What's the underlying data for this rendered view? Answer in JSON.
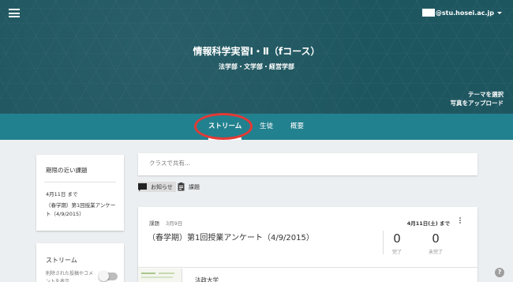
{
  "header": {
    "account_email": "@stu.hosei.ac.jp",
    "course_title": "情報科学実習Ⅰ・Ⅱ（fコース）",
    "course_subtitle": "法学部・文学部・経営学部",
    "theme_select": "テーマを選択",
    "photo_upload": "写真をアップロード"
  },
  "tabs": [
    {
      "label": "ストリーム",
      "active": true
    },
    {
      "label": "生徒",
      "active": false
    },
    {
      "label": "概要",
      "active": false
    }
  ],
  "sidebar": {
    "upcoming_title": "期限の近い課題",
    "upcoming_due": "4月11日 まで",
    "upcoming_item": "（春学期）第1回授業アンケート（4/9/2015）",
    "stream_title": "ストリーム",
    "stream_desc": "削除された投稿やコメントを表示",
    "stream_toggle_on": false
  },
  "share": {
    "placeholder": "クラスで共有..."
  },
  "post_types": {
    "announcement": "お知らせ",
    "assignment": "課題"
  },
  "post": {
    "kind": "課題",
    "date": "3月9日",
    "due": "4月11日(土) まで",
    "title": "（春学期）第1回授業アンケート（4/9/2015）",
    "done_count": "0",
    "done_label": "完了",
    "notdone_count": "0",
    "notdone_label": "未完了",
    "attachment_name": "法政大学"
  },
  "help_label": "?",
  "colors": {
    "banner": "#1e5660",
    "tabbar": "#22818f",
    "highlight": "#e53935"
  }
}
